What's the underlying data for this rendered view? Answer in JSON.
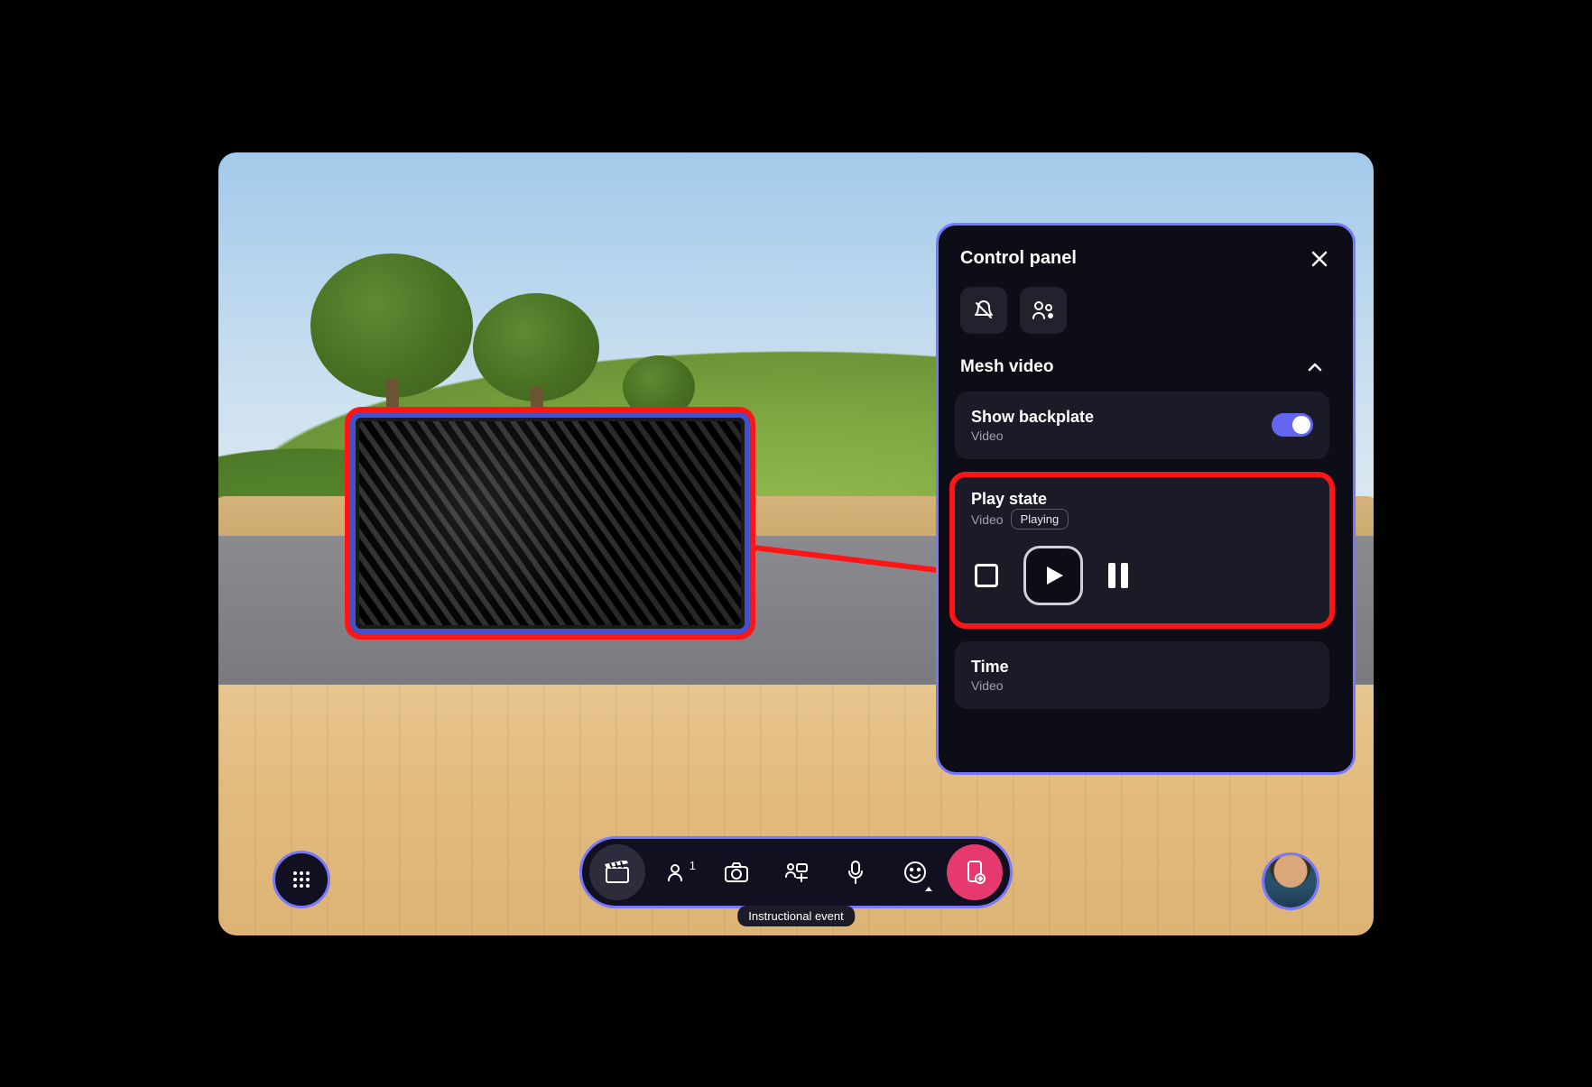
{
  "panel": {
    "title": "Control panel",
    "section": {
      "title": "Mesh video",
      "backplate": {
        "title": "Show backplate",
        "sub": "Video",
        "on": true
      },
      "playstate": {
        "title": "Play state",
        "sub": "Video",
        "status": "Playing"
      },
      "time": {
        "title": "Time",
        "sub": "Video"
      }
    }
  },
  "dock": {
    "participants_count": "1",
    "tooltip": "Instructional event"
  },
  "colors": {
    "accent": "#7878ff",
    "highlight": "#ff1515",
    "danger": "#e63a6e",
    "toggle": "#6366f1"
  }
}
